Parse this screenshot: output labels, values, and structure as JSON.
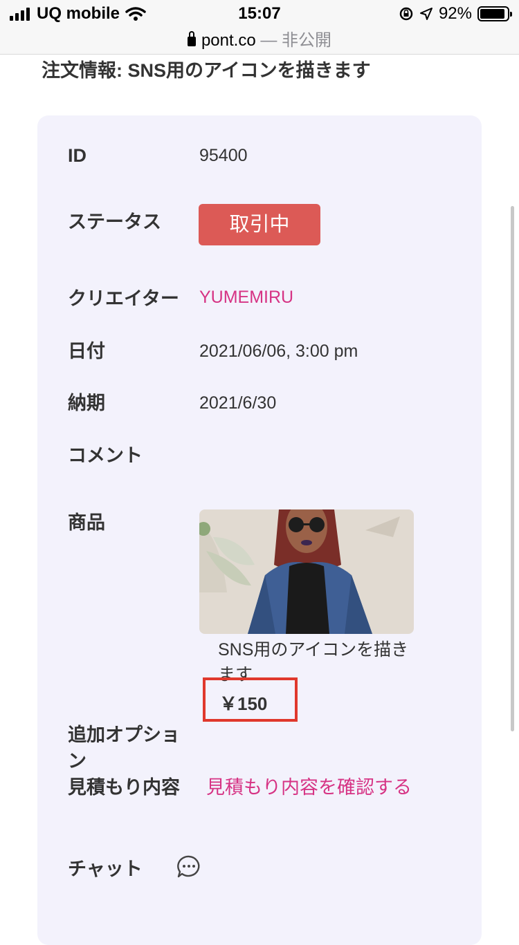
{
  "status_bar": {
    "carrier": "UQ mobile",
    "time": "15:07",
    "battery": "92%",
    "battery_level": 0.92,
    "url": "pont.co",
    "privacy": "— 非公開"
  },
  "page": {
    "title": "注文情報: SNS用のアイコンを描きます"
  },
  "order": {
    "id_label": "ID",
    "id_value": "95400",
    "status_label": "ステータス",
    "status_value": "取引中",
    "status_color": "#dc5a56",
    "creator_label": "クリエイター",
    "creator_value": "YUMEMIRU",
    "date_label": "日付",
    "date_value": "2021/06/06, 3:00 pm",
    "deadline_label": "納期",
    "deadline_value": "2021/6/30",
    "comment_label": "コメント",
    "product_label": "商品",
    "product_name": "SNS用のアイコンを描きます",
    "product_price": "￥150",
    "options_label": "追加オプション",
    "estimate_label": "見積もり内容",
    "estimate_link": "見積もり内容を確認する",
    "chat_label": "チャット"
  },
  "icons": {
    "chat": "chat-bubble-icon",
    "lock": "lock-icon",
    "wifi": "wifi-icon"
  },
  "colors": {
    "accent_pink": "#d63384",
    "card_bg": "#f3f2fc",
    "highlight_red": "#e0382c"
  }
}
